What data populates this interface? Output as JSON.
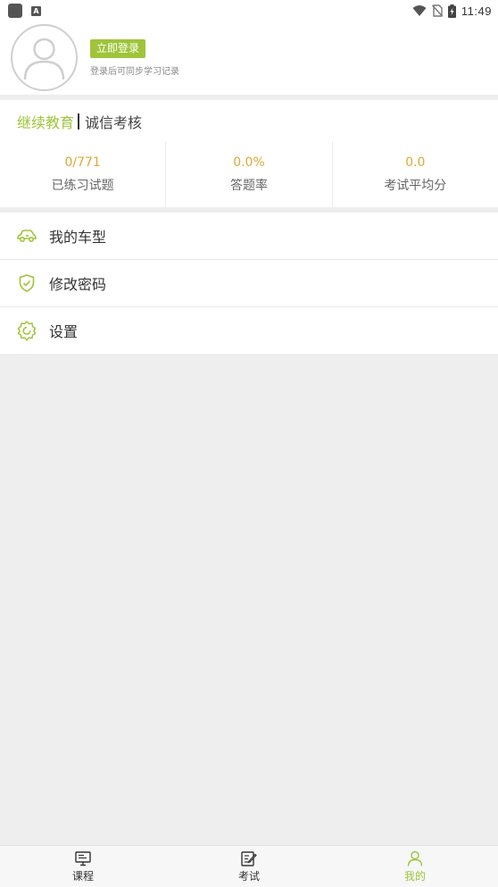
{
  "status_bar": {
    "time": "11:49",
    "icons": [
      "app-notification-icon",
      "a-notification-icon",
      "wifi-icon",
      "no-sim-icon",
      "battery-charging-icon"
    ]
  },
  "profile": {
    "login_button": "立即登录",
    "hint": "登录后可同步学习记录"
  },
  "stats": {
    "title_primary": "继续教育",
    "title_secondary": "诚信考核",
    "items": [
      {
        "value": "0/771",
        "label": "已练习试题"
      },
      {
        "value": "0.0%",
        "label": "答题率"
      },
      {
        "value": "0.0",
        "label": "考试平均分"
      }
    ]
  },
  "menu": {
    "items": [
      {
        "label": "我的车型",
        "icon": "car-icon"
      },
      {
        "label": "修改密码",
        "icon": "shield-check-icon"
      },
      {
        "label": "设置",
        "icon": "gear-icon"
      }
    ]
  },
  "bottom_nav": {
    "items": [
      {
        "label": "课程",
        "icon": "monitor-icon",
        "active": false
      },
      {
        "label": "考试",
        "icon": "edit-paper-icon",
        "active": false
      },
      {
        "label": "我的",
        "icon": "person-icon",
        "active": true
      }
    ]
  },
  "colors": {
    "accent": "#9fc43a",
    "stat_value": "#e0a838",
    "background": "#eeeeee"
  }
}
